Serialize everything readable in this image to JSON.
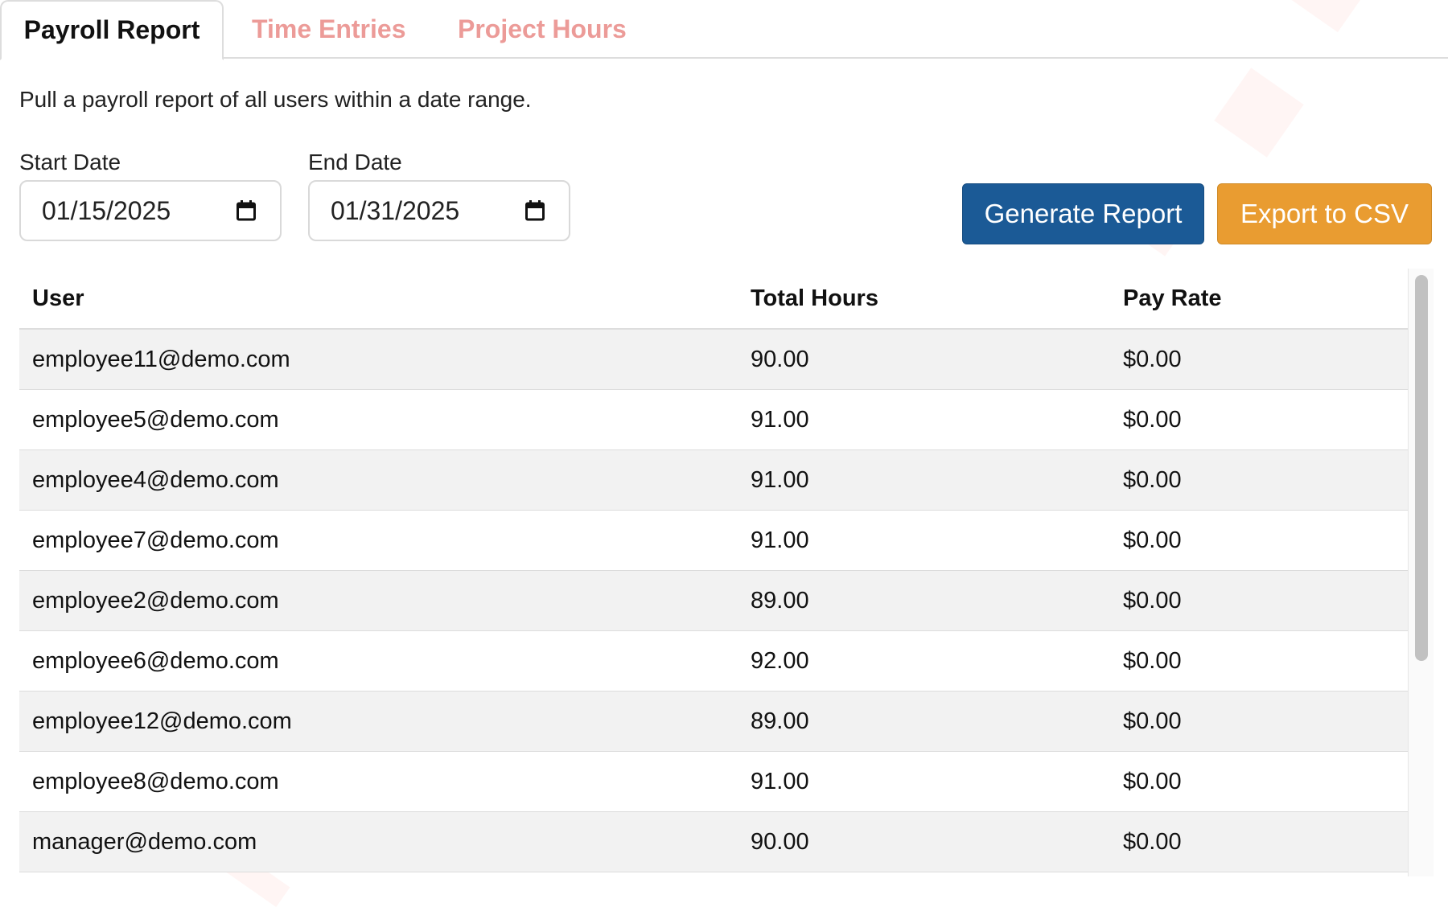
{
  "tabs": [
    {
      "label": "Payroll Report",
      "active": true
    },
    {
      "label": "Time Entries",
      "active": false
    },
    {
      "label": "Project Hours",
      "active": false
    }
  ],
  "intro": "Pull a payroll report of all users within a date range.",
  "form": {
    "start_label": "Start Date",
    "start_value": "01/15/2025",
    "end_label": "End Date",
    "end_value": "01/31/2025",
    "generate_label": "Generate Report",
    "export_label": "Export to CSV"
  },
  "table": {
    "headers": {
      "user": "User",
      "hours": "Total Hours",
      "rate": "Pay Rate"
    },
    "rows": [
      {
        "user": "employee11@demo.com",
        "hours": "90.00",
        "rate": "$0.00"
      },
      {
        "user": "employee5@demo.com",
        "hours": "91.00",
        "rate": "$0.00"
      },
      {
        "user": "employee4@demo.com",
        "hours": "91.00",
        "rate": "$0.00"
      },
      {
        "user": "employee7@demo.com",
        "hours": "91.00",
        "rate": "$0.00"
      },
      {
        "user": "employee2@demo.com",
        "hours": "89.00",
        "rate": "$0.00"
      },
      {
        "user": "employee6@demo.com",
        "hours": "92.00",
        "rate": "$0.00"
      },
      {
        "user": "employee12@demo.com",
        "hours": "89.00",
        "rate": "$0.00"
      },
      {
        "user": "employee8@demo.com",
        "hours": "91.00",
        "rate": "$0.00"
      },
      {
        "user": "manager@demo.com",
        "hours": "90.00",
        "rate": "$0.00"
      }
    ]
  },
  "icons": {
    "date_picker": "calendar-icon"
  },
  "colors": {
    "generate_button": "#1b5a96",
    "export_button": "#e99c31",
    "inactive_tab": "#ec9b98",
    "striped_row": "#f2f2f2"
  }
}
